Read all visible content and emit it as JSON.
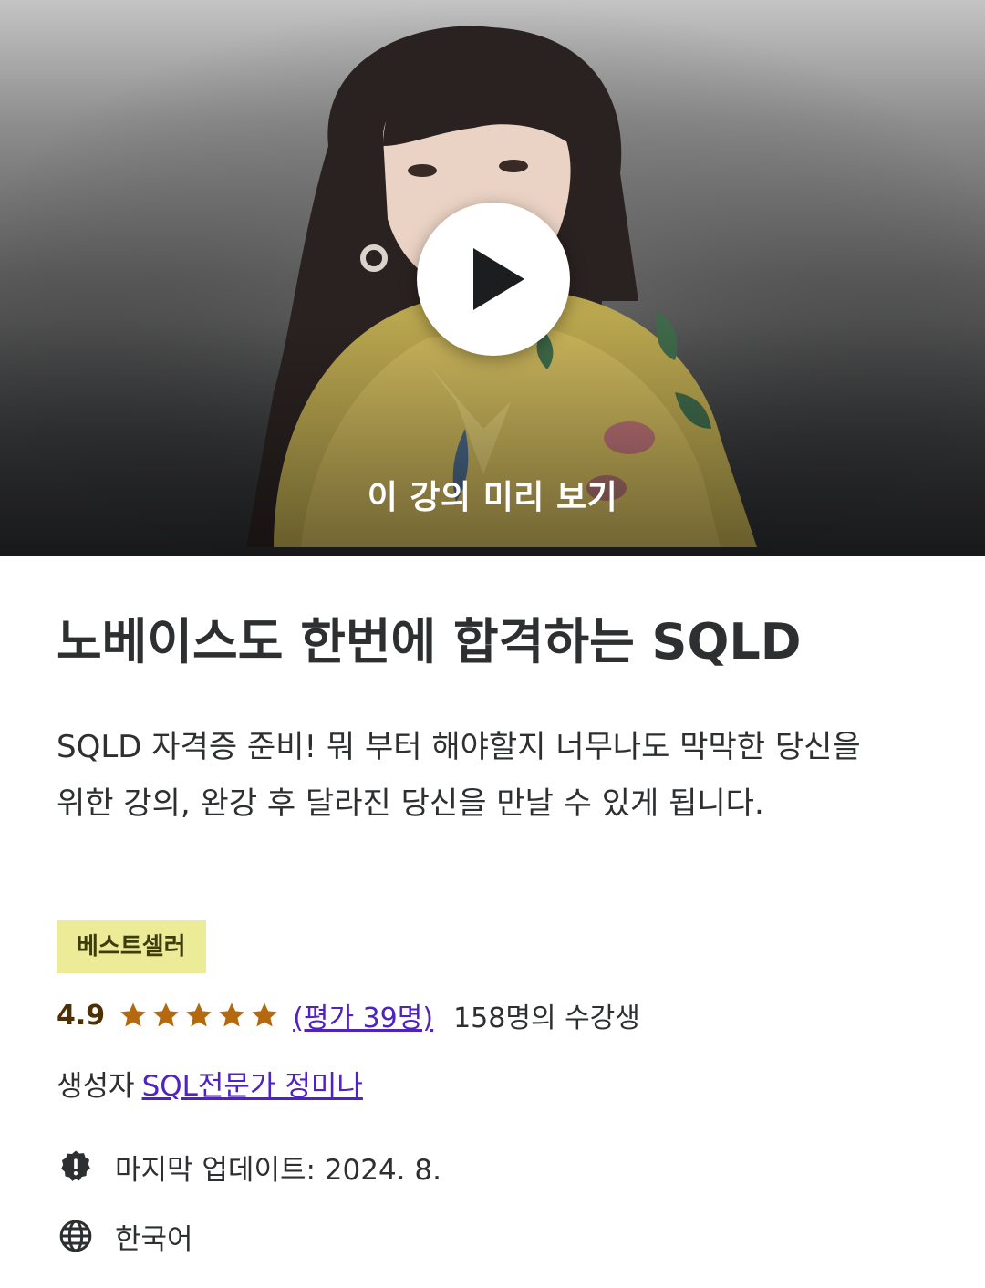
{
  "preview": {
    "label": "이 강의 미리 보기",
    "play_icon": "play-icon"
  },
  "course": {
    "title": "노베이스도 한번에 합격하는 SQLD",
    "description": "SQLD 자격증 준비! 뭐 부터 해야할지 너무나도 막막한 당신을 위한 강의, 완강 후 달라진 당신을 만날 수 있게 됩니다.",
    "badge": "베스트셀러",
    "rating": "4.9",
    "rating_stars": 4.9,
    "rating_max": 5,
    "reviews_link": "(평가 39명)",
    "students": "158명의 수강생",
    "creator_label": "생성자",
    "creator_name": "SQL전문가 정미나",
    "last_updated": "마지막 업데이트: 2024. 8.",
    "language": "한국어"
  },
  "colors": {
    "badge_bg": "#eceb98",
    "badge_text": "#3d3c0a",
    "star": "#b4690e",
    "link": "#5022c3",
    "rating_text": "#4d3105"
  },
  "icons": {
    "update": "alert-badge-icon",
    "language": "globe-icon",
    "star": "star-icon"
  }
}
